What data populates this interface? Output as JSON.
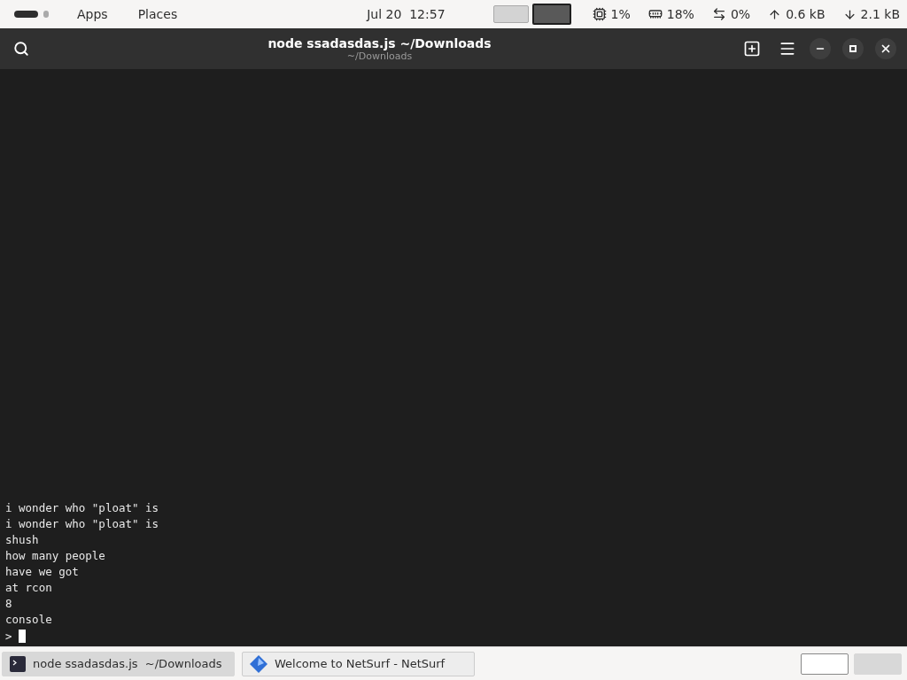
{
  "top_bar": {
    "workspaces": [
      {
        "selected": true
      },
      {
        "selected": false
      }
    ],
    "menus": [
      "Apps",
      "Places"
    ],
    "clock": {
      "date": "Jul 20",
      "time": "12:57"
    },
    "workspace_switcher": [
      {
        "selected": false
      },
      {
        "selected": true
      }
    ],
    "indicators": [
      {
        "kind": "cpu",
        "value": "1%"
      },
      {
        "kind": "memory",
        "value": "18%"
      },
      {
        "kind": "swap",
        "value": "0%"
      },
      {
        "kind": "upload",
        "value": "0.6 kB"
      },
      {
        "kind": "download",
        "value": "2.1 kB"
      }
    ]
  },
  "window": {
    "title": "node ssadasdas.js ~/Downloads",
    "subtitle": "~/Downloads",
    "terminal": {
      "lines": [
        "i wonder who \"ploat\" is",
        "i wonder who \"ploat\" is",
        "shush",
        "how many people",
        "have we got",
        "at rcon",
        "8",
        "console"
      ],
      "prompt": ">"
    }
  },
  "taskbar": {
    "tasks": [
      {
        "kind": "terminal",
        "label": "node ssadasdas.js  ~/Downloads",
        "selected": true
      },
      {
        "kind": "browser",
        "label": "Welcome to NetSurf - NetSurf",
        "selected": false
      }
    ],
    "workspaces": [
      {
        "selected": true
      },
      {
        "selected": false
      }
    ]
  }
}
